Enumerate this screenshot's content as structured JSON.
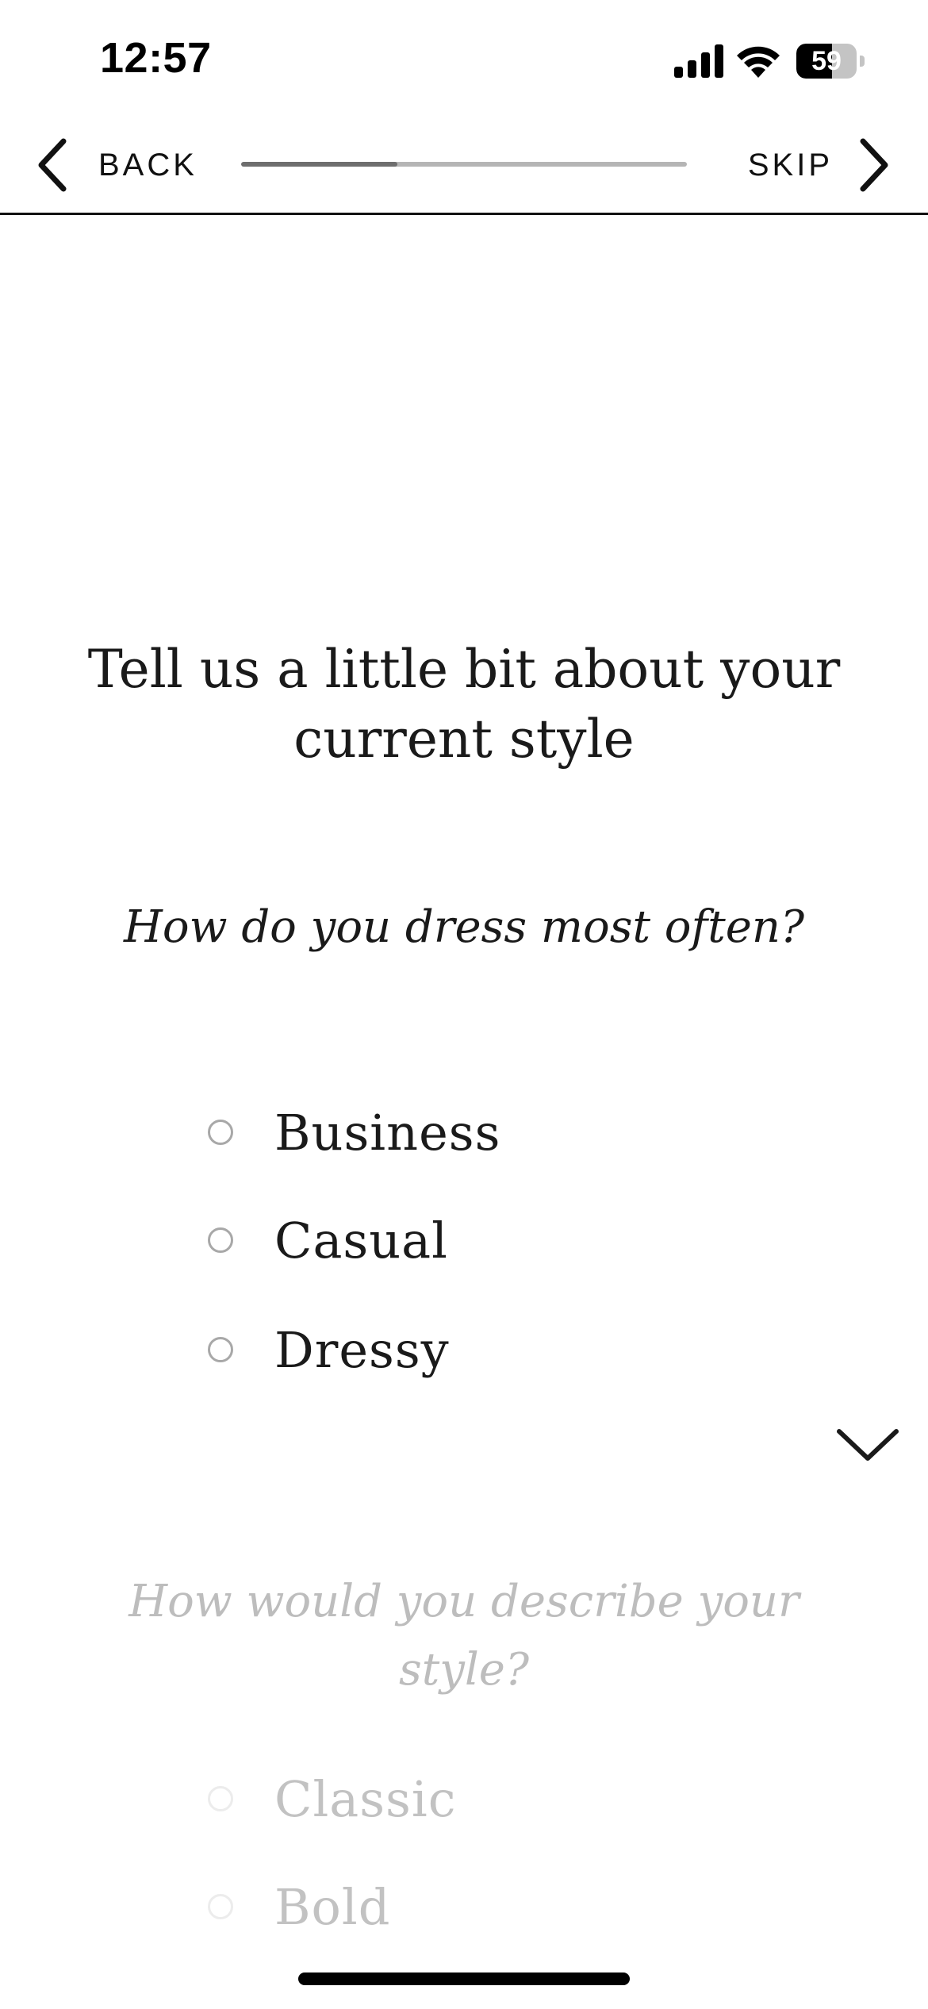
{
  "status_bar": {
    "time": "12:57",
    "battery_level": "59",
    "battery_fraction": 0.59,
    "icons": [
      "signal-icon",
      "wifi-icon",
      "battery-icon"
    ]
  },
  "nav": {
    "back_label": "BACK",
    "skip_label": "SKIP",
    "progress_fraction": 0.35,
    "icons": [
      "chevron-left-icon",
      "chevron-right-icon"
    ]
  },
  "main": {
    "title": "Tell us a little bit about your current style",
    "question_1": {
      "text": "How do you dress most often?",
      "options": [
        "Business",
        "Casual",
        "Dressy"
      ]
    },
    "question_2": {
      "text": "How would you describe your style?",
      "options": [
        "Classic",
        "Bold"
      ]
    },
    "scroll_icon": "chevron-down-icon"
  },
  "colors": {
    "text": "#1a1a1a",
    "faded_text": "#c2c2c2",
    "progress_track": "#b5b5b5",
    "progress_fill": "#6e6e6e"
  }
}
